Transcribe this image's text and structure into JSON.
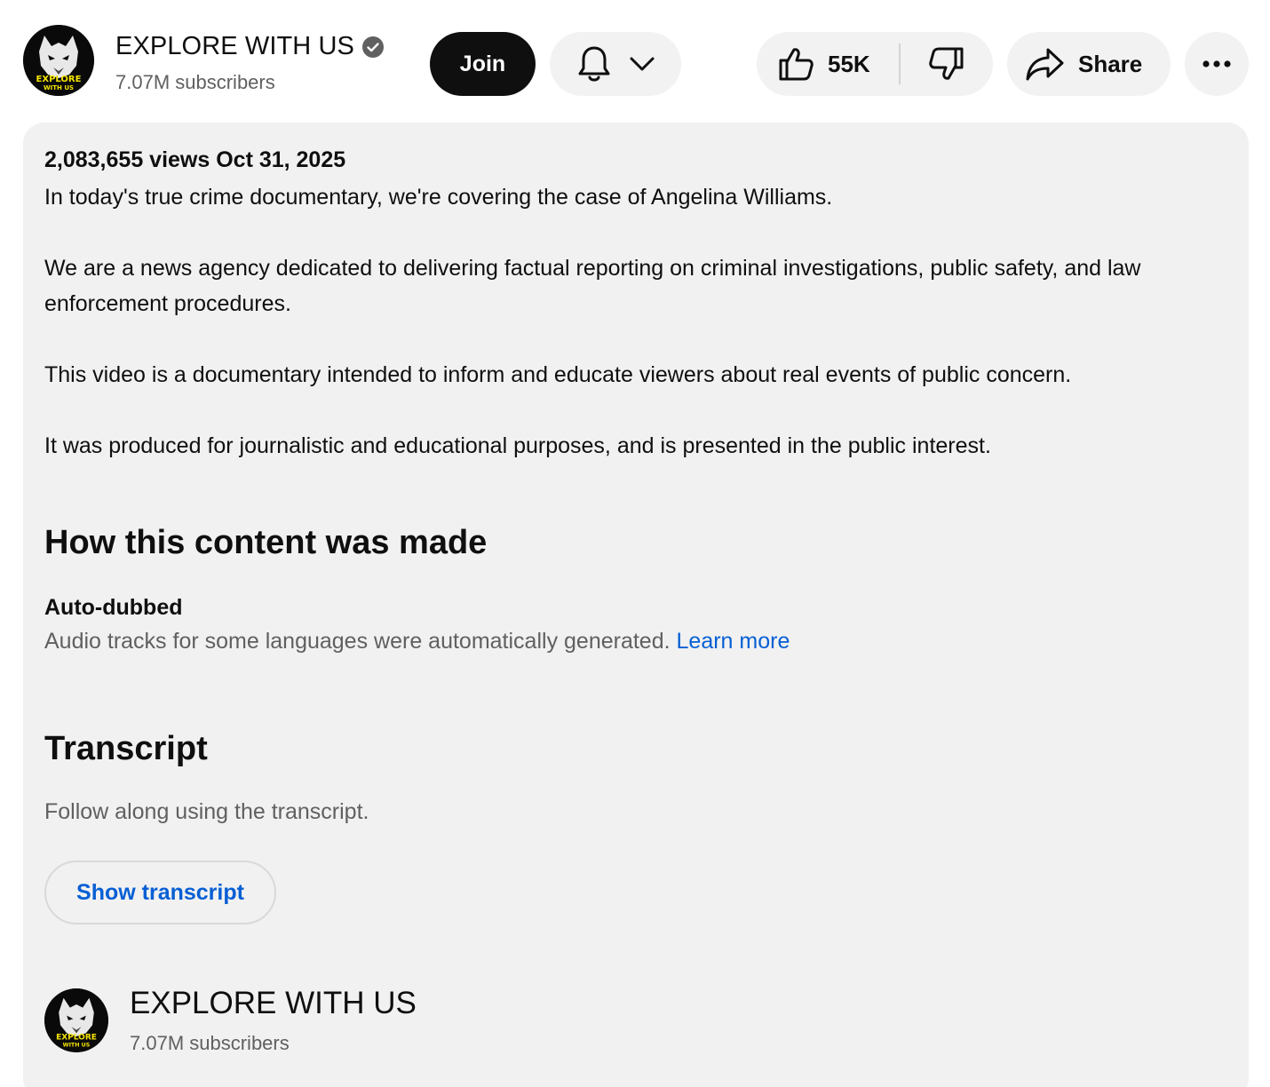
{
  "channel": {
    "name": "EXPLORE WITH US",
    "subscribers": "7.07M subscribers",
    "avatar_text_top": "EXPLORE",
    "avatar_text_bottom": "WITH US",
    "verified": true
  },
  "actions": {
    "join_label": "Join",
    "like_count": "55K",
    "share_label": "Share"
  },
  "description": {
    "meta": "2,083,655 views  Oct 31, 2025",
    "paragraphs": [
      "In today's true crime documentary, we're covering the case of Angelina Williams.",
      "We are a news agency dedicated to delivering factual reporting on criminal investigations, public safety, and law enforcement procedures.",
      "This video is a documentary intended to inform and educate viewers about real events of public concern.",
      "It was produced for journalistic and educational purposes, and is presented in the public interest."
    ]
  },
  "content_made": {
    "heading": "How this content was made",
    "label": "Auto-dubbed",
    "text": "Audio tracks for some languages were automatically generated.",
    "link": "Learn more"
  },
  "transcript": {
    "heading": "Transcript",
    "text": "Follow along using the transcript.",
    "button": "Show transcript"
  },
  "footer_channel": {
    "name": "EXPLORE WITH US",
    "subscribers": "7.07M subscribers"
  },
  "colors": {
    "link": "#065fd4",
    "join_bg": "#0f0f0f",
    "pill_bg": "#f2f2f2",
    "desc_bg": "#f1f1f1",
    "avatar_text": "#f5e400"
  },
  "icons": [
    "verified-badge-icon",
    "bell-icon",
    "chevron-down-icon",
    "thumbs-up-icon",
    "thumbs-down-icon",
    "share-arrow-icon",
    "more-dots-icon"
  ]
}
